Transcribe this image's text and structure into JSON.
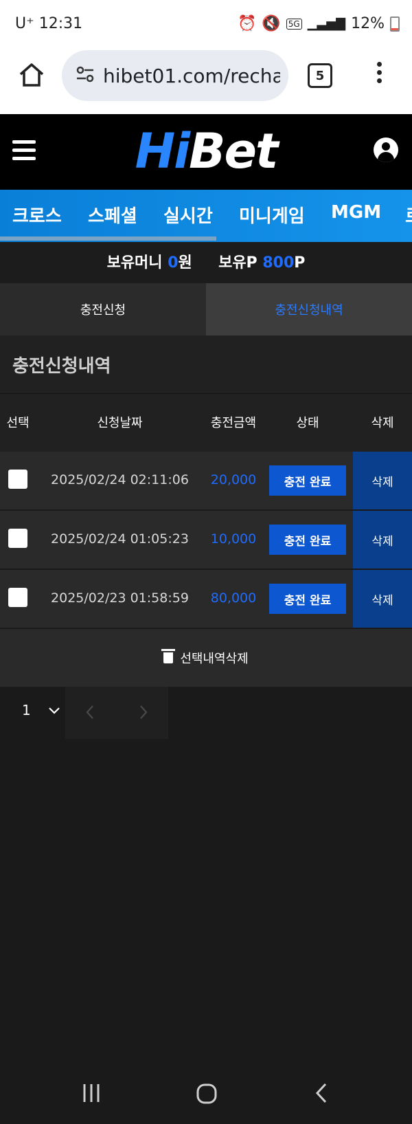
{
  "status_bar": {
    "carrier": "U⁺",
    "time": "12:31",
    "network": "5G",
    "battery": "12%"
  },
  "browser": {
    "url": "hibet01.com/recha",
    "tab_count": "5"
  },
  "site": {
    "logo_hi": "Hi",
    "logo_bet": "Bet",
    "nav": [
      "크로스",
      "스페셜",
      "실시간",
      "미니게임",
      "MGM",
      "로"
    ]
  },
  "money": {
    "money_label": "보유머니",
    "money_value": "0",
    "money_unit": "원",
    "point_label": "보유P",
    "point_value": "800",
    "point_unit": "P"
  },
  "tabs": {
    "request": "충전신청",
    "history": "충전신청내역"
  },
  "section": {
    "title": "충전신청내역"
  },
  "table": {
    "headers": [
      "선택",
      "신청날짜",
      "충전금액",
      "상태",
      "삭제"
    ],
    "rows": [
      {
        "date": "2025/02/24 02:11:06",
        "amount": "20,000",
        "status": "충전 완료",
        "delete": "삭제"
      },
      {
        "date": "2025/02/24 01:05:23",
        "amount": "10,000",
        "status": "충전 완료",
        "delete": "삭제"
      },
      {
        "date": "2025/02/23 01:58:59",
        "amount": "80,000",
        "status": "충전 완료",
        "delete": "삭제"
      }
    ]
  },
  "bulk_delete": {
    "label": "선택내역삭제"
  },
  "pager": {
    "page": "1"
  },
  "colors": {
    "accent_blue": "#1f6cff",
    "status_button": "#0d57d1",
    "delete_button": "#0a3f8e"
  }
}
